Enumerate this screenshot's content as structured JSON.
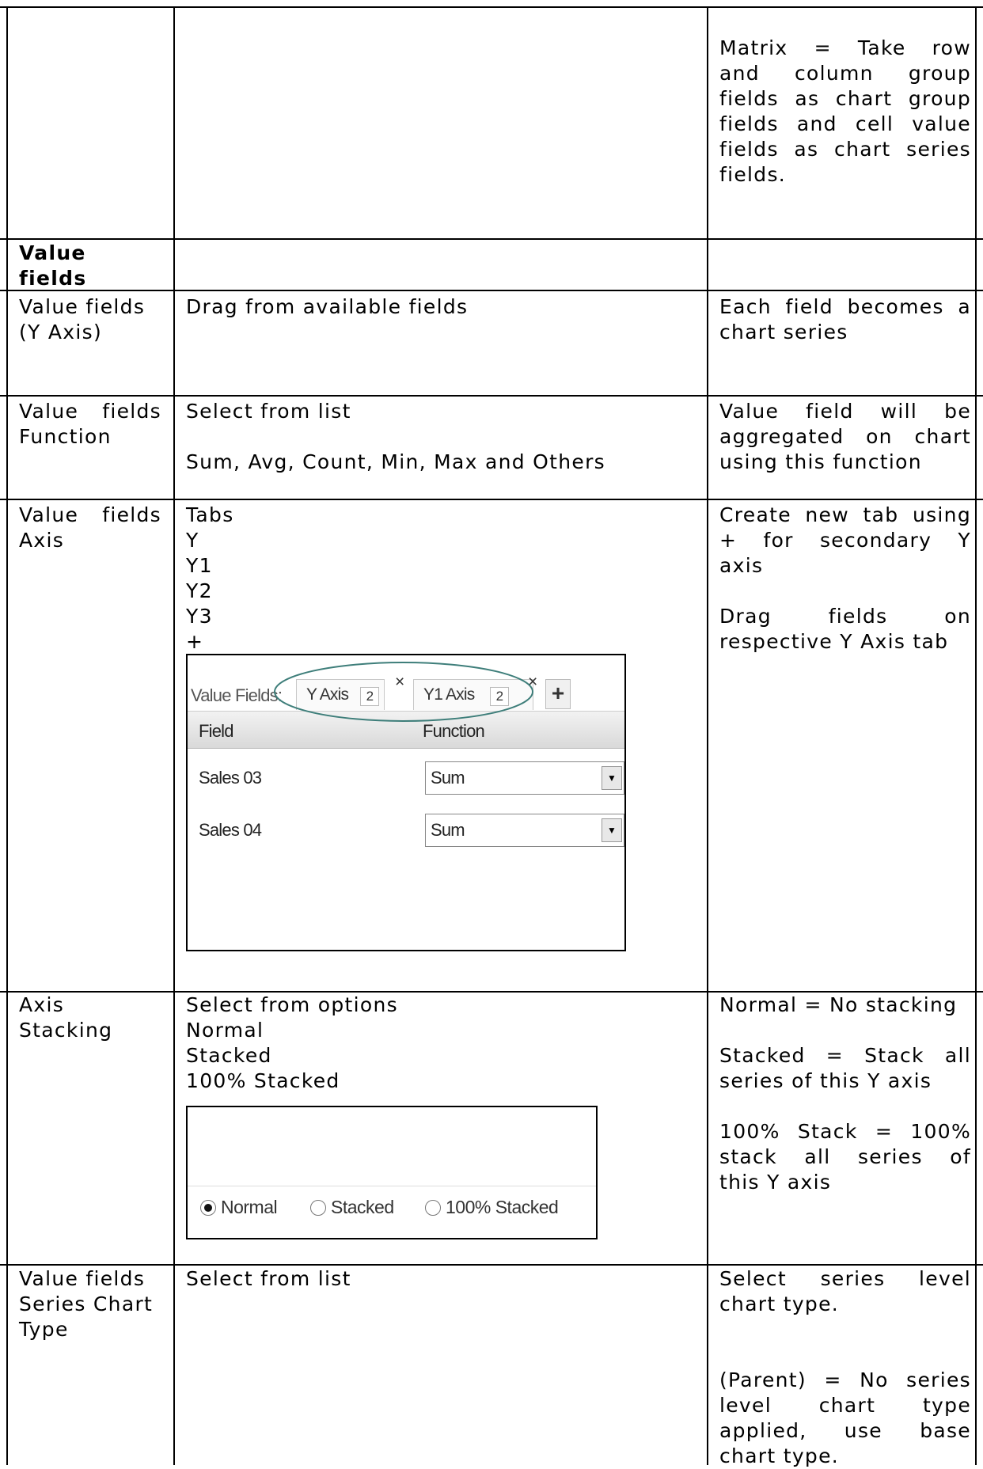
{
  "row_matrix": {
    "col3": [
      "Matrix = Take row",
      "and column group",
      "fields as chart group",
      "fields and cell value",
      "fields as chart series",
      "fields."
    ]
  },
  "row_value_fields_header": {
    "col1": [
      "Value",
      "fields"
    ]
  },
  "row_y_axis": {
    "col1": [
      "Value fields",
      "(Y Axis)"
    ],
    "col2": [
      "Drag from available fields"
    ],
    "col3": [
      "Each field becomes a",
      "chart series"
    ]
  },
  "row_function": {
    "col1": [
      "Value fields",
      "Function"
    ],
    "col2_top": "Select from list",
    "col2_bottom": "Sum, Avg, Count, Min, Max and Others",
    "col3": [
      "Value field will be",
      "aggregated on chart",
      "using this function"
    ]
  },
  "row_axis": {
    "col1": [
      "Value fields",
      "Axis"
    ],
    "col2": [
      "Tabs",
      "Y",
      "Y1",
      "Y2",
      "Y3",
      "+"
    ],
    "col3_a": [
      "Create new tab using",
      "+ for secondary Y",
      "axis"
    ],
    "col3_b": [
      "Drag fields on",
      "respective Y Axis tab"
    ],
    "screenshot": {
      "label": "Value Fields:",
      "tabs": [
        {
          "name": "Y Axis",
          "count": "2",
          "close": "×"
        },
        {
          "name": "Y1 Axis",
          "count": "2",
          "close": "×"
        }
      ],
      "add": "+",
      "headers": {
        "field": "Field",
        "function": "Function"
      },
      "rows": [
        {
          "field": "Sales 03",
          "function": "Sum"
        },
        {
          "field": "Sales 04",
          "function": "Sum"
        }
      ]
    }
  },
  "row_stacking": {
    "col1": [
      "Axis",
      "Stacking"
    ],
    "col2": [
      "Select from options",
      "Normal",
      "Stacked",
      "100% Stacked"
    ],
    "col3_a": [
      "Normal = No stacking"
    ],
    "col3_b": [
      "Stacked = Stack all",
      "series of this Y axis"
    ],
    "col3_c": [
      "100% Stack = 100%",
      "stack all series of",
      "this Y axis"
    ],
    "screenshot": {
      "options": [
        {
          "label": "Normal",
          "selected": true
        },
        {
          "label": "Stacked",
          "selected": false
        },
        {
          "label": "100% Stacked",
          "selected": false
        }
      ]
    }
  },
  "row_series_type": {
    "col1": [
      "Value fields",
      "Series Chart",
      "Type"
    ],
    "col2": [
      "Select from list"
    ],
    "col3_a": [
      "Select series level",
      "chart type."
    ],
    "col3_b": [
      "(Parent) = No series",
      "level chart type",
      "applied, use base",
      "chart type."
    ]
  }
}
